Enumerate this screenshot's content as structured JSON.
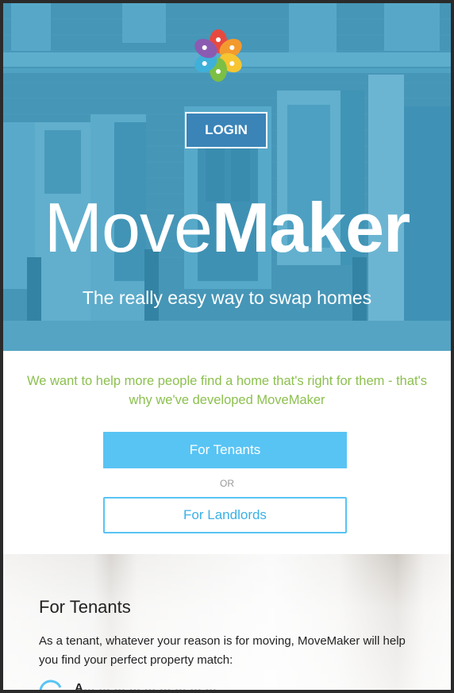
{
  "hero": {
    "login_label": "LOGIN",
    "brand_light": "Move",
    "brand_bold": "Maker",
    "tagline": "The really easy way to swap homes"
  },
  "intro": {
    "text": "We want to help more people find a home that's right for them - that's why we've developed MoveMaker",
    "tenants_button": "For Tenants",
    "or_label": "OR",
    "landlords_button": "For Landlords"
  },
  "tenants_section": {
    "title": "For Tenants",
    "text": "As a tenant, whatever your reason is for moving, MoveMaker will help you find your perfect property match:",
    "first_item_partial": "A… … … … … … … … …"
  },
  "colors": {
    "hero_tint": "#43a0c4",
    "login_bg": "#3a84b8",
    "intro_text": "#8cc04f",
    "primary_button": "#58c4f4"
  },
  "icons": [
    "movemaker-logo-icon",
    "check-circle-icon"
  ]
}
